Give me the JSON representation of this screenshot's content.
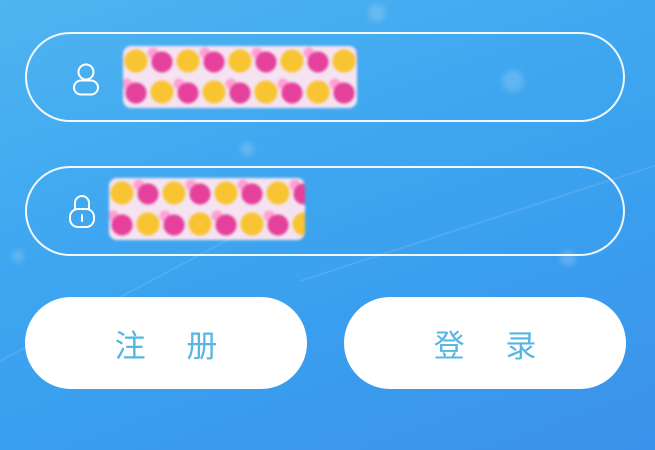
{
  "form": {
    "username": {
      "icon": "user-icon",
      "value": "",
      "obscured_by": "emoji-sticker"
    },
    "password": {
      "icon": "lock-icon",
      "value": "",
      "obscured_by": "emoji-sticker"
    }
  },
  "buttons": {
    "register_label": "注 册",
    "login_label": "登 录"
  },
  "colors": {
    "background_top": "#4fb4f0",
    "background_bottom": "#3c92ea",
    "field_border": "#ffffff",
    "button_bg": "#ffffff",
    "button_text": "#58b6e2",
    "sticker_face": "#f8c431",
    "sticker_heart": "#e5409b"
  }
}
